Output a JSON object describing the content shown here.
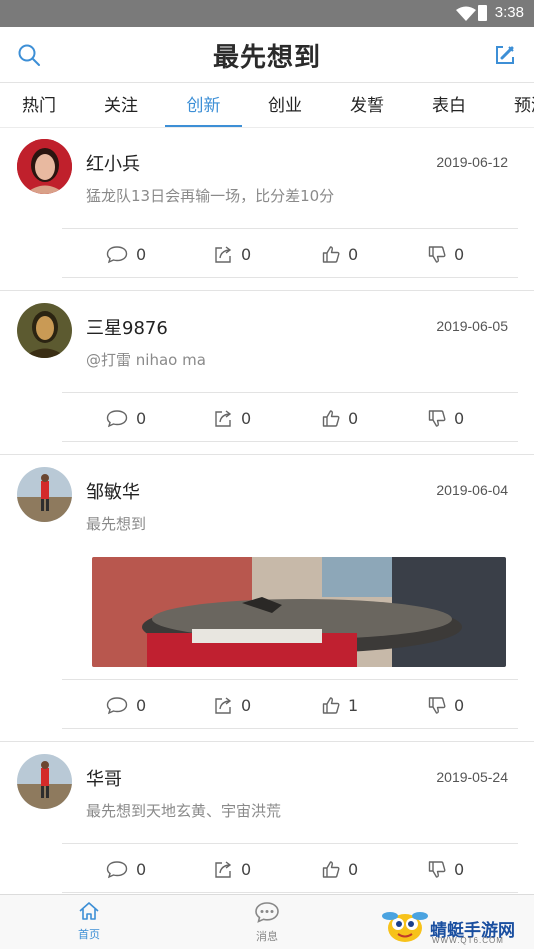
{
  "status_bar": {
    "time": "3:38"
  },
  "header": {
    "title": "最先想到"
  },
  "tabs": [
    {
      "label": "热门"
    },
    {
      "label": "关注"
    },
    {
      "label": "创新"
    },
    {
      "label": "创业"
    },
    {
      "label": "发誓"
    },
    {
      "label": "表白"
    },
    {
      "label": "预测"
    }
  ],
  "active_tab": "创新",
  "posts": [
    {
      "name": "红小兵",
      "date": "2019-06-12",
      "content": "猛龙队13日会再输一场，比分差10分",
      "comments": "0",
      "shares": "0",
      "likes": "0",
      "dislikes": "0"
    },
    {
      "name": "三星9876",
      "date": "2019-06-05",
      "content": "@打雷 nihao ma",
      "comments": "0",
      "shares": "0",
      "likes": "0",
      "dislikes": "0"
    },
    {
      "name": "邹敏华",
      "date": "2019-06-04",
      "content": "最先想到",
      "comments": "0",
      "shares": "0",
      "likes": "1",
      "dislikes": "0"
    },
    {
      "name": "华哥",
      "date": "2019-05-24",
      "content": "最先想到天地玄黄、宇宙洪荒",
      "comments": "0",
      "shares": "0",
      "likes": "0",
      "dislikes": "0"
    }
  ],
  "bottom_nav": [
    {
      "label": "首页",
      "icon": "home-icon"
    },
    {
      "label": "消息",
      "icon": "chat-icon"
    }
  ],
  "watermark": {
    "text": "蜻蜓手游网",
    "url": "WWW.QT6.COM"
  },
  "colors": {
    "accent": "#3d8fd6",
    "status_bar": "#7a7a7a"
  }
}
